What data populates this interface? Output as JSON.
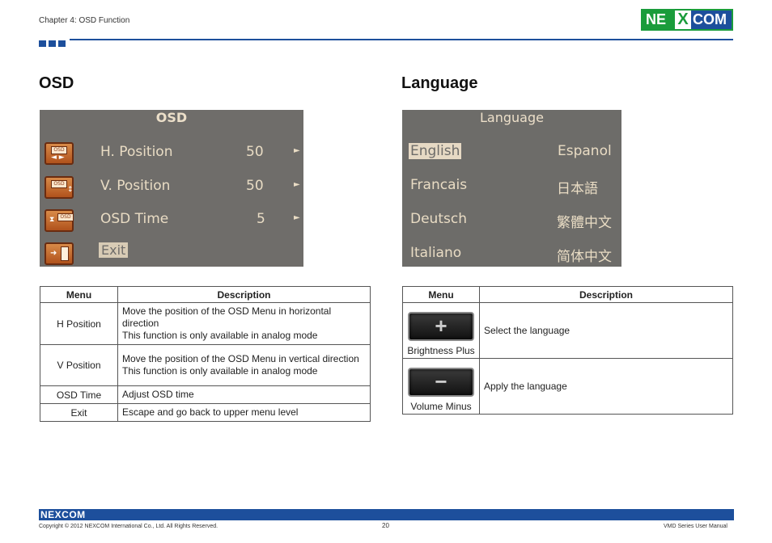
{
  "header": {
    "chapter": "Chapter 4: OSD Function",
    "logo": "NEXCOM"
  },
  "osd_section": {
    "title": "OSD",
    "screen": {
      "title": "OSD",
      "rows": [
        {
          "label": "H. Position",
          "value": "50",
          "icon_text": "OSD"
        },
        {
          "label": "V. Position",
          "value": "50",
          "icon_text": "OSD"
        },
        {
          "label": "OSD Time",
          "value": "5",
          "icon_text": "OSD"
        },
        {
          "label": "Exit"
        }
      ]
    },
    "table": {
      "headers": [
        "Menu",
        "Description"
      ],
      "rows": [
        {
          "menu": "H Position",
          "desc1": "Move the position of the OSD Menu in horizontal direction",
          "desc2": "This function is only available in analog mode"
        },
        {
          "menu": "V Position",
          "desc1": "Move the position of the OSD Menu in vertical direction",
          "desc2": "This function is only available in analog mode"
        },
        {
          "menu": "OSD Time",
          "desc1": "Adjust OSD time"
        },
        {
          "menu": "Exit",
          "desc1": "Escape and go back to upper menu level"
        }
      ]
    }
  },
  "language_section": {
    "title": "Language",
    "screen": {
      "title": "Language",
      "left": [
        "English",
        "Francais",
        "Deutsch",
        "Italiano"
      ],
      "right": [
        "Espanol",
        "日本語",
        "繁體中文",
        "简体中文"
      ]
    },
    "table": {
      "headers": [
        "Menu",
        "Description"
      ],
      "rows": [
        {
          "key_symbol": "+",
          "menu": "Brightness Plus",
          "desc": "Select the language"
        },
        {
          "key_symbol": "−",
          "menu": "Volume Minus",
          "desc": "Apply the language"
        }
      ]
    }
  },
  "footer": {
    "logo": "NEXCOM",
    "copyright": "Copyright © 2012 NEXCOM International Co., Ltd. All Rights Reserved.",
    "page": "20",
    "manual": "VMD Series User Manual"
  },
  "colors": {
    "brand_blue": "#1d4f9c",
    "brand_green": "#1a9c3b"
  }
}
